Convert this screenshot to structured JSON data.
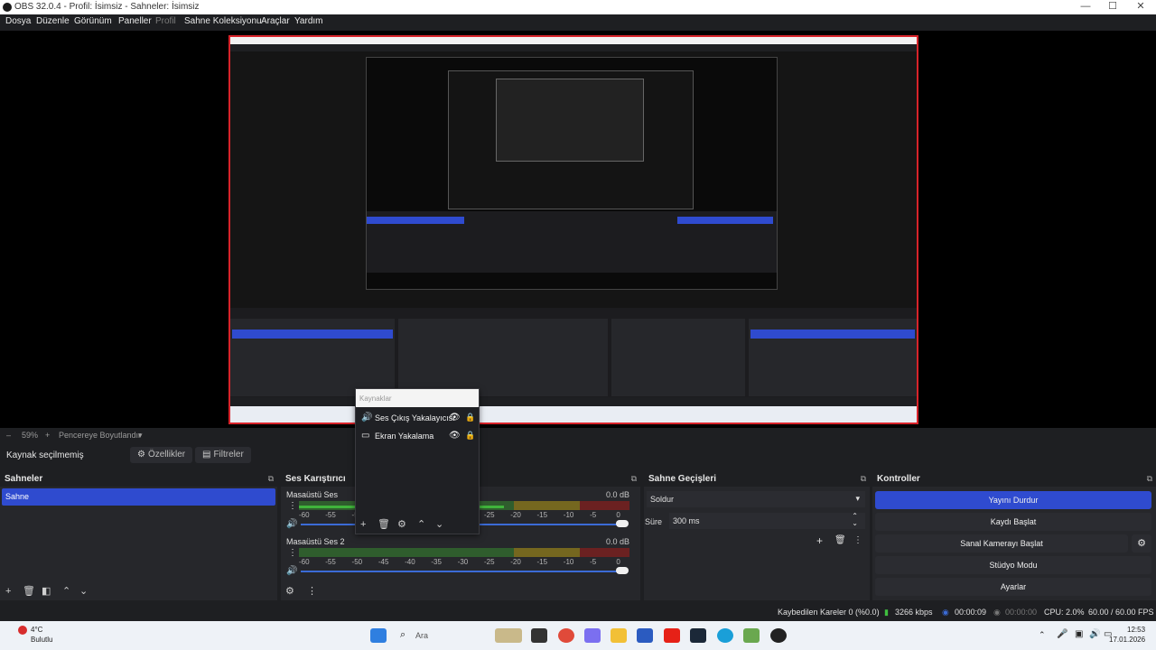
{
  "window": {
    "title": "OBS 32.0.4 - Profil: İsimsiz - Sahneler: İsimsiz",
    "buttons": {
      "min": "—",
      "max": "☐",
      "close": "✕"
    }
  },
  "menu": [
    {
      "label": "Dosya",
      "enabled": true
    },
    {
      "label": "Düzenle",
      "enabled": true
    },
    {
      "label": "Görünüm",
      "enabled": true
    },
    {
      "label": "Paneller",
      "enabled": true
    },
    {
      "label": "Profil",
      "enabled": false
    },
    {
      "label": "Sahne Koleksiyonu",
      "enabled": true
    },
    {
      "label": "Araçlar",
      "enabled": true
    },
    {
      "label": "Yardım",
      "enabled": true
    }
  ],
  "zoom": {
    "minus": "–",
    "value": "59%",
    "plus": "+",
    "fit": "Pencereye Boyutlandır",
    "chevron": "▾"
  },
  "source_bar": {
    "label": "Kaynak seçilmemiş",
    "properties": "Özellikler",
    "filters": "Filtreler"
  },
  "scenes": {
    "title": "Sahneler",
    "items": [
      "Sahne"
    ]
  },
  "mixer": {
    "title": "Ses Karıştırıcı",
    "channels": [
      {
        "name": "Masaüstü Ses",
        "db": "0.0 dB"
      },
      {
        "name": "Masaüstü Ses 2",
        "db": "0.0 dB"
      }
    ],
    "ticks": [
      "-60",
      "-55",
      "-50",
      "-45",
      "-40",
      "-35",
      "-30",
      "-25",
      "-20",
      "-15",
      "-10",
      "-5",
      "0"
    ]
  },
  "transitions": {
    "title": "Sahne Geçişleri",
    "selected": "Soldur",
    "duration_label": "Süre",
    "duration_value": "300 ms"
  },
  "controls": {
    "title": "Kontroller",
    "stop_stream": "Yayını Durdur",
    "start_recording": "Kaydı Başlat",
    "start_virtual_cam": "Sanal Kamerayı Başlat",
    "studio_mode": "Stüdyo Modu",
    "settings": "Ayarlar"
  },
  "sources_popup": {
    "title": "Kaynaklar",
    "items": [
      {
        "name": "Ses Çıkış Yakalayıcısı",
        "icon": "speaker-icon"
      },
      {
        "name": "Ekran Yakalama",
        "icon": "monitor-icon"
      }
    ]
  },
  "status": {
    "dropped": "Kaybedilen Kareler 0 (%0.0)",
    "bitrate": "3266 kbps",
    "stream_time": "00:00:09",
    "rec_time": "00:00:00",
    "cpu": "CPU: 2.0%",
    "fps": "60.00 / 60.00 FPS"
  },
  "taskbar": {
    "temp": "4°C",
    "weather": "Bulutlu",
    "search": "Ara",
    "time": "12:53",
    "date": "17.01.2026"
  },
  "colors": {
    "accent": "#2f4bcf",
    "live": "#d8232a"
  }
}
